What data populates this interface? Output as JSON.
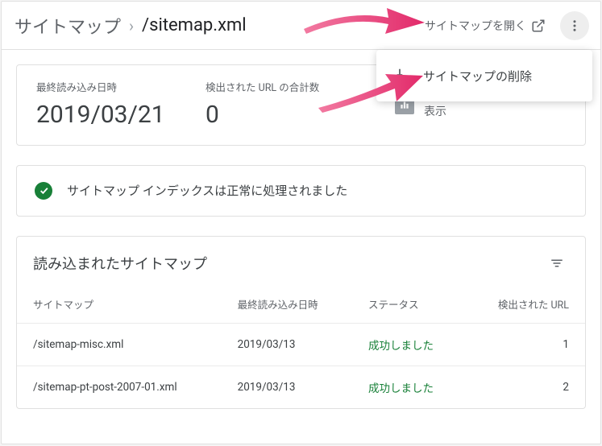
{
  "header": {
    "breadcrumb_root": "サイトマップ",
    "breadcrumb_current": "/sitemap.xml",
    "open_label": "サイトマップを開く"
  },
  "menu": {
    "delete_label": "サイトマップの削除"
  },
  "stats": {
    "last_read_label": "最終読み込み日時",
    "last_read_value": "2019/03/21",
    "url_count_label": "検出された URL の合計数",
    "url_count_value": "0",
    "coverage_label": "インデックス カバレッジを表示"
  },
  "status": {
    "message": "サイトマップ インデックスは正常に処理されました"
  },
  "table": {
    "title": "読み込まれたサイトマップ",
    "columns": {
      "sitemap": "サイトマップ",
      "last_read": "最終読み込み日時",
      "status": "ステータス",
      "urls": "検出された URL"
    },
    "rows": [
      {
        "sitemap": "/sitemap-misc.xml",
        "last_read": "2019/03/13",
        "status": "成功しました",
        "urls": "1"
      },
      {
        "sitemap": "/sitemap-pt-post-2007-01.xml",
        "last_read": "2019/03/13",
        "status": "成功しました",
        "urls": "2"
      }
    ]
  },
  "colors": {
    "success": "#188038",
    "arrow": "#e8407a"
  }
}
